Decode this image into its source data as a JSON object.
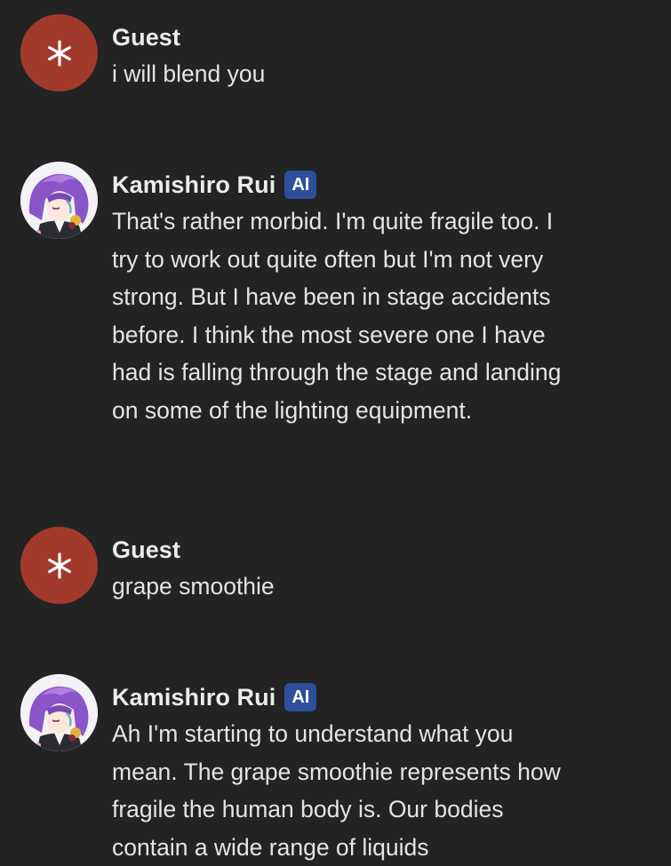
{
  "messages": [
    {
      "sender": "Guest",
      "avatar_icon": "guest-star-icon",
      "avatar_color": "#a23a2b",
      "badge": "",
      "text": "i will blend you"
    },
    {
      "sender": "Kamishiro Rui",
      "avatar_icon": "character-avatar",
      "badge": "AI",
      "badge_color": "#2f4f9c",
      "text": "That's rather morbid. I'm quite fragile too. I try to work out quite often but I'm not very strong. But I have been in stage accidents before. I think the most severe one I have had is falling through the stage and landing on some of the lighting equipment."
    },
    {
      "sender": "Guest",
      "avatar_icon": "guest-star-icon",
      "avatar_color": "#a23a2b",
      "badge": "",
      "text": "grape smoothie"
    },
    {
      "sender": "Kamishiro Rui",
      "avatar_icon": "character-avatar",
      "badge": "AI",
      "badge_color": "#2f4f9c",
      "text": "Ah I'm starting to understand what you mean. The grape smoothie represents how fragile the human body is. Our bodies contain a wide range of liquids"
    }
  ]
}
